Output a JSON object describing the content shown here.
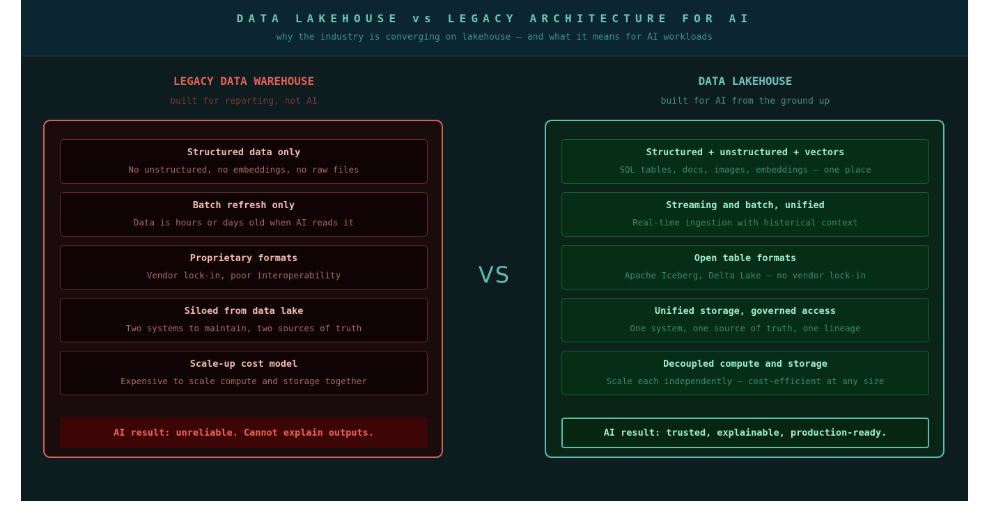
{
  "header": {
    "title": "DATA LAKEHOUSE vs LEGACY ARCHITECTURE FOR AI",
    "subtitle": "why the industry is converging on lakehouse — and what it means for AI workloads"
  },
  "vs_label": "VS",
  "legacy": {
    "title": "LEGACY DATA WAREHOUSE",
    "subtitle": "built for reporting, not AI",
    "items": [
      {
        "title": "Structured data only",
        "desc": "No unstructured, no embeddings, no raw files"
      },
      {
        "title": "Batch refresh only",
        "desc": "Data is hours or days old when AI reads it"
      },
      {
        "title": "Proprietary formats",
        "desc": "Vendor lock-in, poor interoperability"
      },
      {
        "title": "Siloed from data lake",
        "desc": "Two systems to maintain, two sources of truth"
      },
      {
        "title": "Scale-up cost model",
        "desc": "Expensive to scale compute and storage together"
      }
    ],
    "result": "AI result: unreliable. Cannot explain outputs."
  },
  "lakehouse": {
    "title": "DATA LAKEHOUSE",
    "subtitle": "built for AI from the ground up",
    "items": [
      {
        "title": "Structured + unstructured + vectors",
        "desc": "SQL tables, docs, images, embeddings — one place"
      },
      {
        "title": "Streaming and batch, unified",
        "desc": "Real-time ingestion with historical context"
      },
      {
        "title": "Open table formats",
        "desc": "Apache Iceberg, Delta Lake — no vendor lock-in"
      },
      {
        "title": "Unified storage, governed access",
        "desc": "One system, one source of truth, one lineage"
      },
      {
        "title": "Decoupled compute and storage",
        "desc": "Scale each independently — cost-efficient at any size"
      }
    ],
    "result": "AI result: trusted, explainable, production-ready."
  },
  "colors": {
    "legacy_accent": "#e0605a",
    "lakehouse_accent": "#5ac2a6",
    "background": "#0d1c1f"
  }
}
